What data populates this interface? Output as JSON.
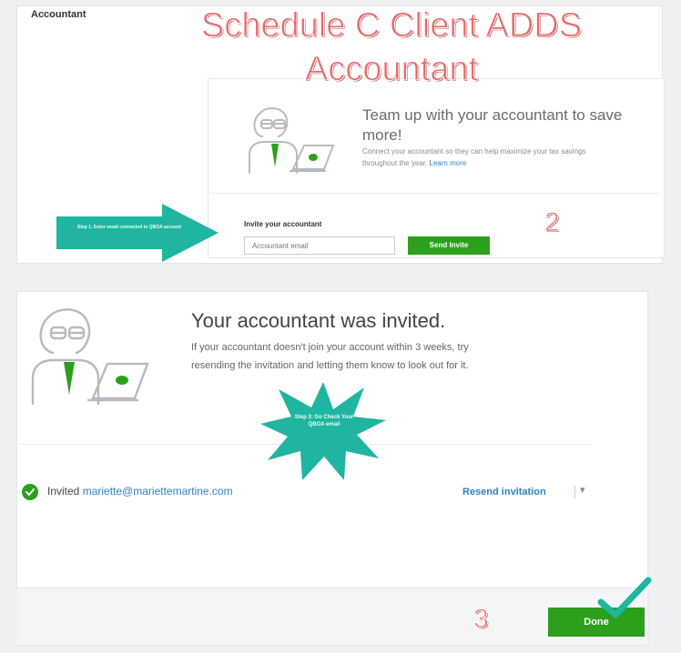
{
  "header": {
    "section_label": "Accountant",
    "title_line1": "Schedule C Client ADDS",
    "title_line2": "Accountant"
  },
  "card_top": {
    "heading_line1": "Team up with your accountant to save",
    "heading_line2": "more!",
    "desc_line1": "Connect your accountant so they can help maximize your tax savings",
    "desc_line2_prefix": "throughout the year.",
    "desc_link": "Learn more",
    "invite_label": "Invite your accountant",
    "email_placeholder": "Accountant email",
    "send_button": "Send Invite"
  },
  "annotations": {
    "arrow_text": "Step 1: Enter email connected to QBOA account",
    "step2": "2",
    "star_text": "Step 3: Go Check Your QBOA email",
    "step3": "3"
  },
  "card_bottom": {
    "heading": "Your accountant was invited.",
    "desc_line1": "If your accountant doesn't join your account within 3 weeks, try",
    "desc_line2": "resending the invitation and letting them know to look out for it.",
    "invited_label": "Invited",
    "invited_email": "mariette@mariettemartine.com",
    "resend_label": "Resend invitation",
    "resend_caret": "▾",
    "done_button": "Done"
  },
  "colors": {
    "brand_green": "#2ca01c",
    "link_blue": "#2f82c4",
    "annotation_teal": "#1fb5a0",
    "title_red": "#e46a6a"
  },
  "icons": [
    "accountant-illustration",
    "laptop-icon",
    "arrow-annotation",
    "starburst-annotation",
    "check-circle-icon",
    "checkmark-icon"
  ]
}
